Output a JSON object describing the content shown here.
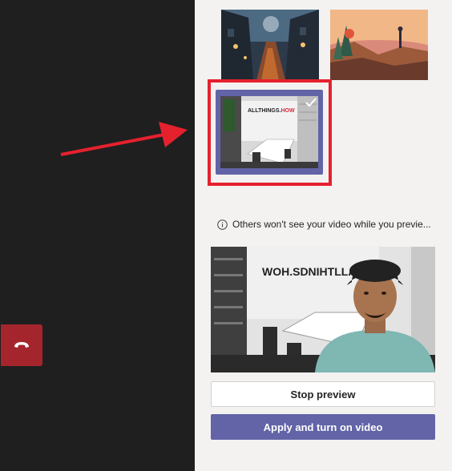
{
  "window": {
    "hangup_icon": "phone-hangup-icon",
    "accent_color": "#6264a7",
    "hangup_color": "#a4262c",
    "annotation_color": "#e5212e"
  },
  "backgrounds": {
    "items": [
      {
        "name": "fantasy-street-background",
        "selected": false
      },
      {
        "name": "autumn-landscape-background",
        "selected": false
      },
      {
        "name": "allthings-how-office-background",
        "selected": true,
        "sign_text_prefix": "ALLTHINGS.",
        "sign_text_accent": "HOW"
      }
    ],
    "selected_icon": "checkmark-icon"
  },
  "notice": {
    "icon": "info-icon",
    "text": "Others won't see your video while you previe..."
  },
  "preview": {
    "sign_text_mirrored": "WOH.SDNIHTLLA"
  },
  "actions": {
    "stop_preview_label": "Stop preview",
    "apply_label": "Apply and turn on video"
  }
}
